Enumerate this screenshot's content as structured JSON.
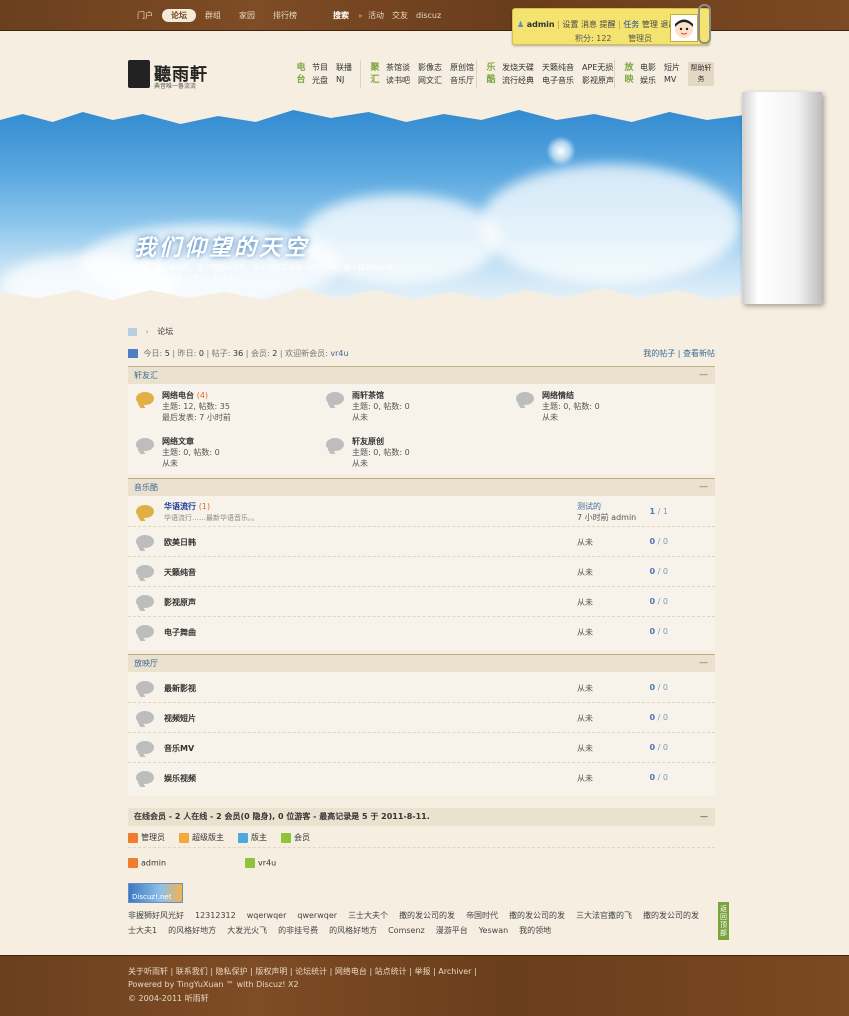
{
  "topnav": {
    "items": [
      "门户",
      "论坛",
      "群组",
      "家园",
      "排行榜"
    ],
    "search": "搜索",
    "quick": [
      "活动",
      "交友",
      "discuz"
    ]
  },
  "user": {
    "name": "admin",
    "links": [
      "设置",
      "消息",
      "提醒"
    ],
    "task": "任务",
    "manage": "管理",
    "logout": "退出",
    "credits": "积分: 122",
    "group": "管理员"
  },
  "logo": {
    "name": "聽雨軒",
    "slogan": "典音唯一魯流流"
  },
  "nav": [
    {
      "label": "电台",
      "links": [
        "节目",
        "光盘",
        "联播",
        "NJ"
      ]
    },
    {
      "label": "聚汇",
      "links": [
        "茶馆谈",
        "读书吧",
        "影像志",
        "网文汇",
        "原创馆",
        "音乐厅"
      ]
    },
    {
      "label": "乐酷",
      "links": [
        "发烧天碟",
        "流行经典",
        "天籁纯音",
        "电子音乐",
        "APE无损",
        "影视原声"
      ]
    },
    {
      "label": "放映",
      "links": [
        "电影",
        "娱乐",
        "短片",
        "MV"
      ]
    }
  ],
  "help": "帮助轩务",
  "banner": {
    "title": "我们仰望的天空",
    "sub1": "每天，我们看到的，是个精彩的世界，你不想用耳朵听一听，一样，是个精彩的世界",
    "sub2": "听雨轩网络电台 与音乐一起流浪"
  },
  "crumb": "论坛",
  "stats": {
    "today_label": "今日:",
    "today": "5",
    "yesterday_label": "昨日:",
    "yesterday": "0",
    "posts_label": "帖子:",
    "posts": "36",
    "members_label": "会员:",
    "members": "2",
    "welcome": "欢迎新会员:",
    "newuser": "vr4u",
    "myposts": "我的帖子",
    "newposts": "查看新帖"
  },
  "cat1": {
    "title": "轩友汇",
    "forums": [
      {
        "name": "网络电台",
        "today": "(4)",
        "stat": "主题: 12, 帖数: 35",
        "last": "最后发表: 7 小时前"
      },
      {
        "name": "雨轩茶馆",
        "stat": "主题: 0, 帖数: 0",
        "last": "从未"
      },
      {
        "name": "网络情结",
        "stat": "主题: 0, 帖数: 0",
        "last": "从未"
      },
      {
        "name": "网络文章",
        "stat": "主题: 0, 帖数: 0",
        "last": "从未"
      },
      {
        "name": "轩友原创",
        "stat": "主题: 0, 帖数: 0",
        "last": "从未"
      }
    ]
  },
  "cat2": {
    "title": "音乐酷",
    "forums": [
      {
        "name": "华语流行",
        "today": "(1)",
        "desc": "华语流行……最新华语音乐。。",
        "count_a": "1",
        "count_b": "1",
        "last_title": "测试的",
        "last_info": "7 小时前 admin"
      },
      {
        "name": "欧美日韩",
        "count_a": "0",
        "count_b": "0",
        "last": "从未"
      },
      {
        "name": "天籁纯音",
        "count_a": "0",
        "count_b": "0",
        "last": "从未"
      },
      {
        "name": "影视原声",
        "count_a": "0",
        "count_b": "0",
        "last": "从未"
      },
      {
        "name": "电子舞曲",
        "count_a": "0",
        "count_b": "0",
        "last": "从未"
      }
    ]
  },
  "cat3": {
    "title": "放映厅",
    "forums": [
      {
        "name": "最新影视",
        "count_a": "0",
        "count_b": "0",
        "last": "从未"
      },
      {
        "name": "视频短片",
        "count_a": "0",
        "count_b": "0",
        "last": "从未"
      },
      {
        "name": "音乐MV",
        "count_a": "0",
        "count_b": "0",
        "last": "从未"
      },
      {
        "name": "娱乐视频",
        "count_a": "0",
        "count_b": "0",
        "last": "从未"
      }
    ]
  },
  "online": {
    "text": "在线会员 - 2 人在线 - 2 会员(0 隐身), 0 位游客 - 最高记录是 5 于 2011-8-11.",
    "legend": [
      "管理员",
      "超级版主",
      "版主",
      "会员"
    ],
    "users": [
      "admin",
      "vr4u"
    ],
    "colors": [
      "#f07d2e",
      "#f3a83b",
      "#4ea8e0",
      "#8fc43a"
    ]
  },
  "friendlinks_logo": "Discuz!.net",
  "friendlinks": [
    "非握狮好风光好",
    "12312312",
    "wqerwqer",
    "qwerwqer",
    "三士大夫个",
    "撒的发公司的发",
    "帝国时代",
    "撒的发公司的发",
    "三大法官撒的飞",
    "撒的发公司的发",
    "士大夫1",
    "的风格好地方",
    "大发光火飞",
    "的非挂号费",
    "的风格好地方",
    "Comsenz",
    "漫游平台",
    "Yeswan",
    "我的领地"
  ],
  "backtop": "返回顶部",
  "footer": {
    "links": "关于听雨轩 | 联系我们 | 隐私保护 | 版权声明 | 论坛统计 | 网络电台 | 站点统计 | 举报 | Archiver |",
    "powered": "Powered by TingYuXuan ™ with Discuz! X2",
    "copy": "© 2004-2011 听雨轩"
  }
}
